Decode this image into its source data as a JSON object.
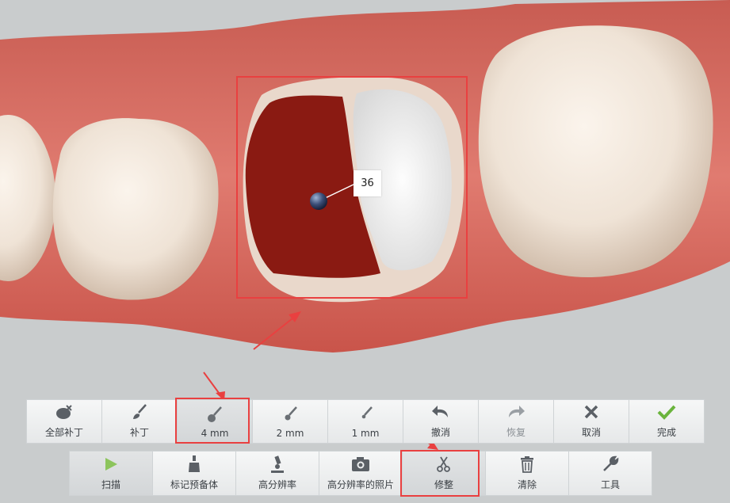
{
  "toolbar_top": {
    "items": [
      {
        "label": "全部补丁",
        "icon": "patch-all-icon"
      },
      {
        "label": "补丁",
        "icon": "brush-icon"
      },
      {
        "label": "4 mm",
        "icon": "brush-4mm-icon"
      },
      {
        "label": "2 mm",
        "icon": "brush-2mm-icon"
      },
      {
        "label": "1 mm",
        "icon": "brush-1mm-icon"
      },
      {
        "label": "撤消",
        "icon": "undo-icon"
      },
      {
        "label": "恢复",
        "icon": "redo-icon"
      },
      {
        "label": "取消",
        "icon": "close-icon"
      },
      {
        "label": "完成",
        "icon": "check-icon"
      }
    ]
  },
  "toolbar_bottom": {
    "items": [
      {
        "label": "扫描",
        "icon": "play-icon"
      },
      {
        "label": "标记预备体",
        "icon": "mark-preparation-icon"
      },
      {
        "label": "高分辨率",
        "icon": "microscope-icon"
      },
      {
        "label": "高分辨率的照片",
        "icon": "camera-icon"
      },
      {
        "label": "修整",
        "icon": "scissors-icon"
      },
      {
        "label": "清除",
        "icon": "trash-icon"
      },
      {
        "label": "工具",
        "icon": "wrench-icon"
      }
    ]
  },
  "viewport": {
    "tooth_number": "36"
  },
  "colors": {
    "accent_red": "#e94040",
    "gum": "#d5655c",
    "selected_region": "#8a1a12",
    "check_green": "#6ab43c"
  }
}
